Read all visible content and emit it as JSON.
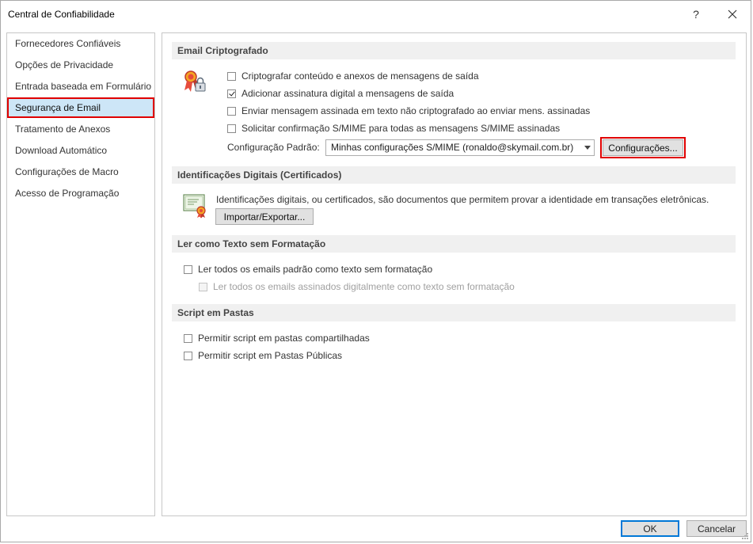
{
  "window": {
    "title": "Central de Confiabilidade",
    "help_label": "?",
    "close_label": "✕"
  },
  "nav": {
    "items": [
      {
        "label": "Fornecedores Confiáveis"
      },
      {
        "label": "Opções de Privacidade"
      },
      {
        "label": "Entrada baseada em Formulário"
      },
      {
        "label": "Segurança de Email"
      },
      {
        "label": "Tratamento de Anexos"
      },
      {
        "label": "Download Automático"
      },
      {
        "label": "Configurações de Macro"
      },
      {
        "label": "Acesso de Programação"
      }
    ],
    "selected": "Segurança de Email"
  },
  "email_crypto": {
    "header": "Email Criptografado",
    "options": [
      {
        "label": "Criptografar conteúdo e anexos de mensagens de saída",
        "checked": false
      },
      {
        "label": "Adicionar assinatura digital a mensagens de saída",
        "checked": true
      },
      {
        "label": "Enviar mensagem assinada em texto não criptografado ao enviar mens. assinadas",
        "checked": false
      },
      {
        "label": "Solicitar confirmação S/MIME para todas as mensagens S/MIME assinadas",
        "checked": false
      }
    ],
    "default_config_label": "Configuração Padrão:",
    "default_config_value": "Minhas configurações S/MIME (ronaldo@skymail.com.br)",
    "settings_button": "Configurações..."
  },
  "digital_ids": {
    "header": "Identificações Digitais (Certificados)",
    "description": "Identificações digitais, ou certificados, são documentos que permitem provar a identidade em transações eletrônicas.",
    "import_export_button": "Importar/Exportar..."
  },
  "plain_text": {
    "header": "Ler como Texto sem Formatação",
    "options": [
      {
        "label": "Ler todos os emails padrão como texto sem formatação",
        "checked": false,
        "enabled": true
      },
      {
        "label": "Ler todos os emails assinados digitalmente como texto sem formatação",
        "checked": false,
        "enabled": false
      }
    ]
  },
  "script_folders": {
    "header": "Script em Pastas",
    "options": [
      {
        "label": "Permitir script em pastas compartilhadas",
        "checked": false
      },
      {
        "label": "Permitir script em Pastas Públicas",
        "checked": false
      }
    ]
  },
  "footer": {
    "ok_label": "OK",
    "cancel_label": "Cancelar"
  },
  "colors": {
    "selection_bg": "#cde6f7",
    "highlight_red": "#e00000",
    "section_bg": "#f0f0f0",
    "ok_border": "#0078d7"
  }
}
